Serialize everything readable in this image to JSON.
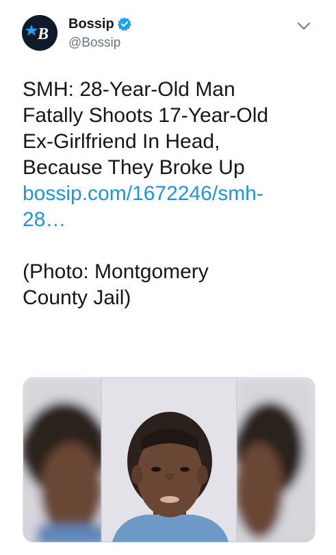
{
  "account": {
    "display_name": "Bossip",
    "handle": "@Bossip",
    "avatar_icon": "bossip-logo-icon",
    "avatar_letter": "B",
    "verified_icon": "verified-badge-icon",
    "verified_color": "#1da1f2"
  },
  "menu": {
    "icon": "chevron-down-icon"
  },
  "tweet": {
    "text_lines": [
      "SMH: 28-Year-Old Man",
      "Fatally Shoots 17-Year-Old",
      "Ex-Girlfriend In Head,",
      "Because They Broke Up"
    ],
    "link_lines": [
      "bossip.com/1672246/smh-",
      "28…"
    ],
    "link_color": "#1b95e0",
    "caption_lines": [
      "(Photo: Montgomery",
      "County Jail)"
    ]
  },
  "media": {
    "icon": "mugshot-photo"
  }
}
